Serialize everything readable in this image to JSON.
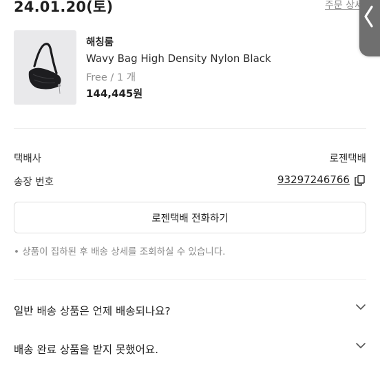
{
  "order": {
    "date": "24.01.20(토)",
    "detail_link": "주문 상세"
  },
  "product": {
    "brand": "해칭룸",
    "name": "Wavy Bag High Density Nylon Black",
    "option": "Free / 1 개",
    "price": "144,445원",
    "image_icon": "black-nylon-shoulder-bag"
  },
  "delivery": {
    "courier_label": "택배사",
    "courier_value": "로젠택배",
    "tracking_label": "송장 번호",
    "tracking_number": "93297246766",
    "call_button_label": "로젠택배 전화하기",
    "notice": "• 상품이 집하된 후 배송 상세를 조회하실 수 있습니다."
  },
  "faq": [
    {
      "question": "일반 배송 상품은 언제 배송되나요?"
    },
    {
      "question": "배송 완료 상품을 받지 못했어요."
    }
  ],
  "colors": {
    "text_primary": "#222222",
    "text_secondary": "#8c8c8c",
    "divider": "#ededed",
    "side_tab": "#6f6f6f"
  }
}
